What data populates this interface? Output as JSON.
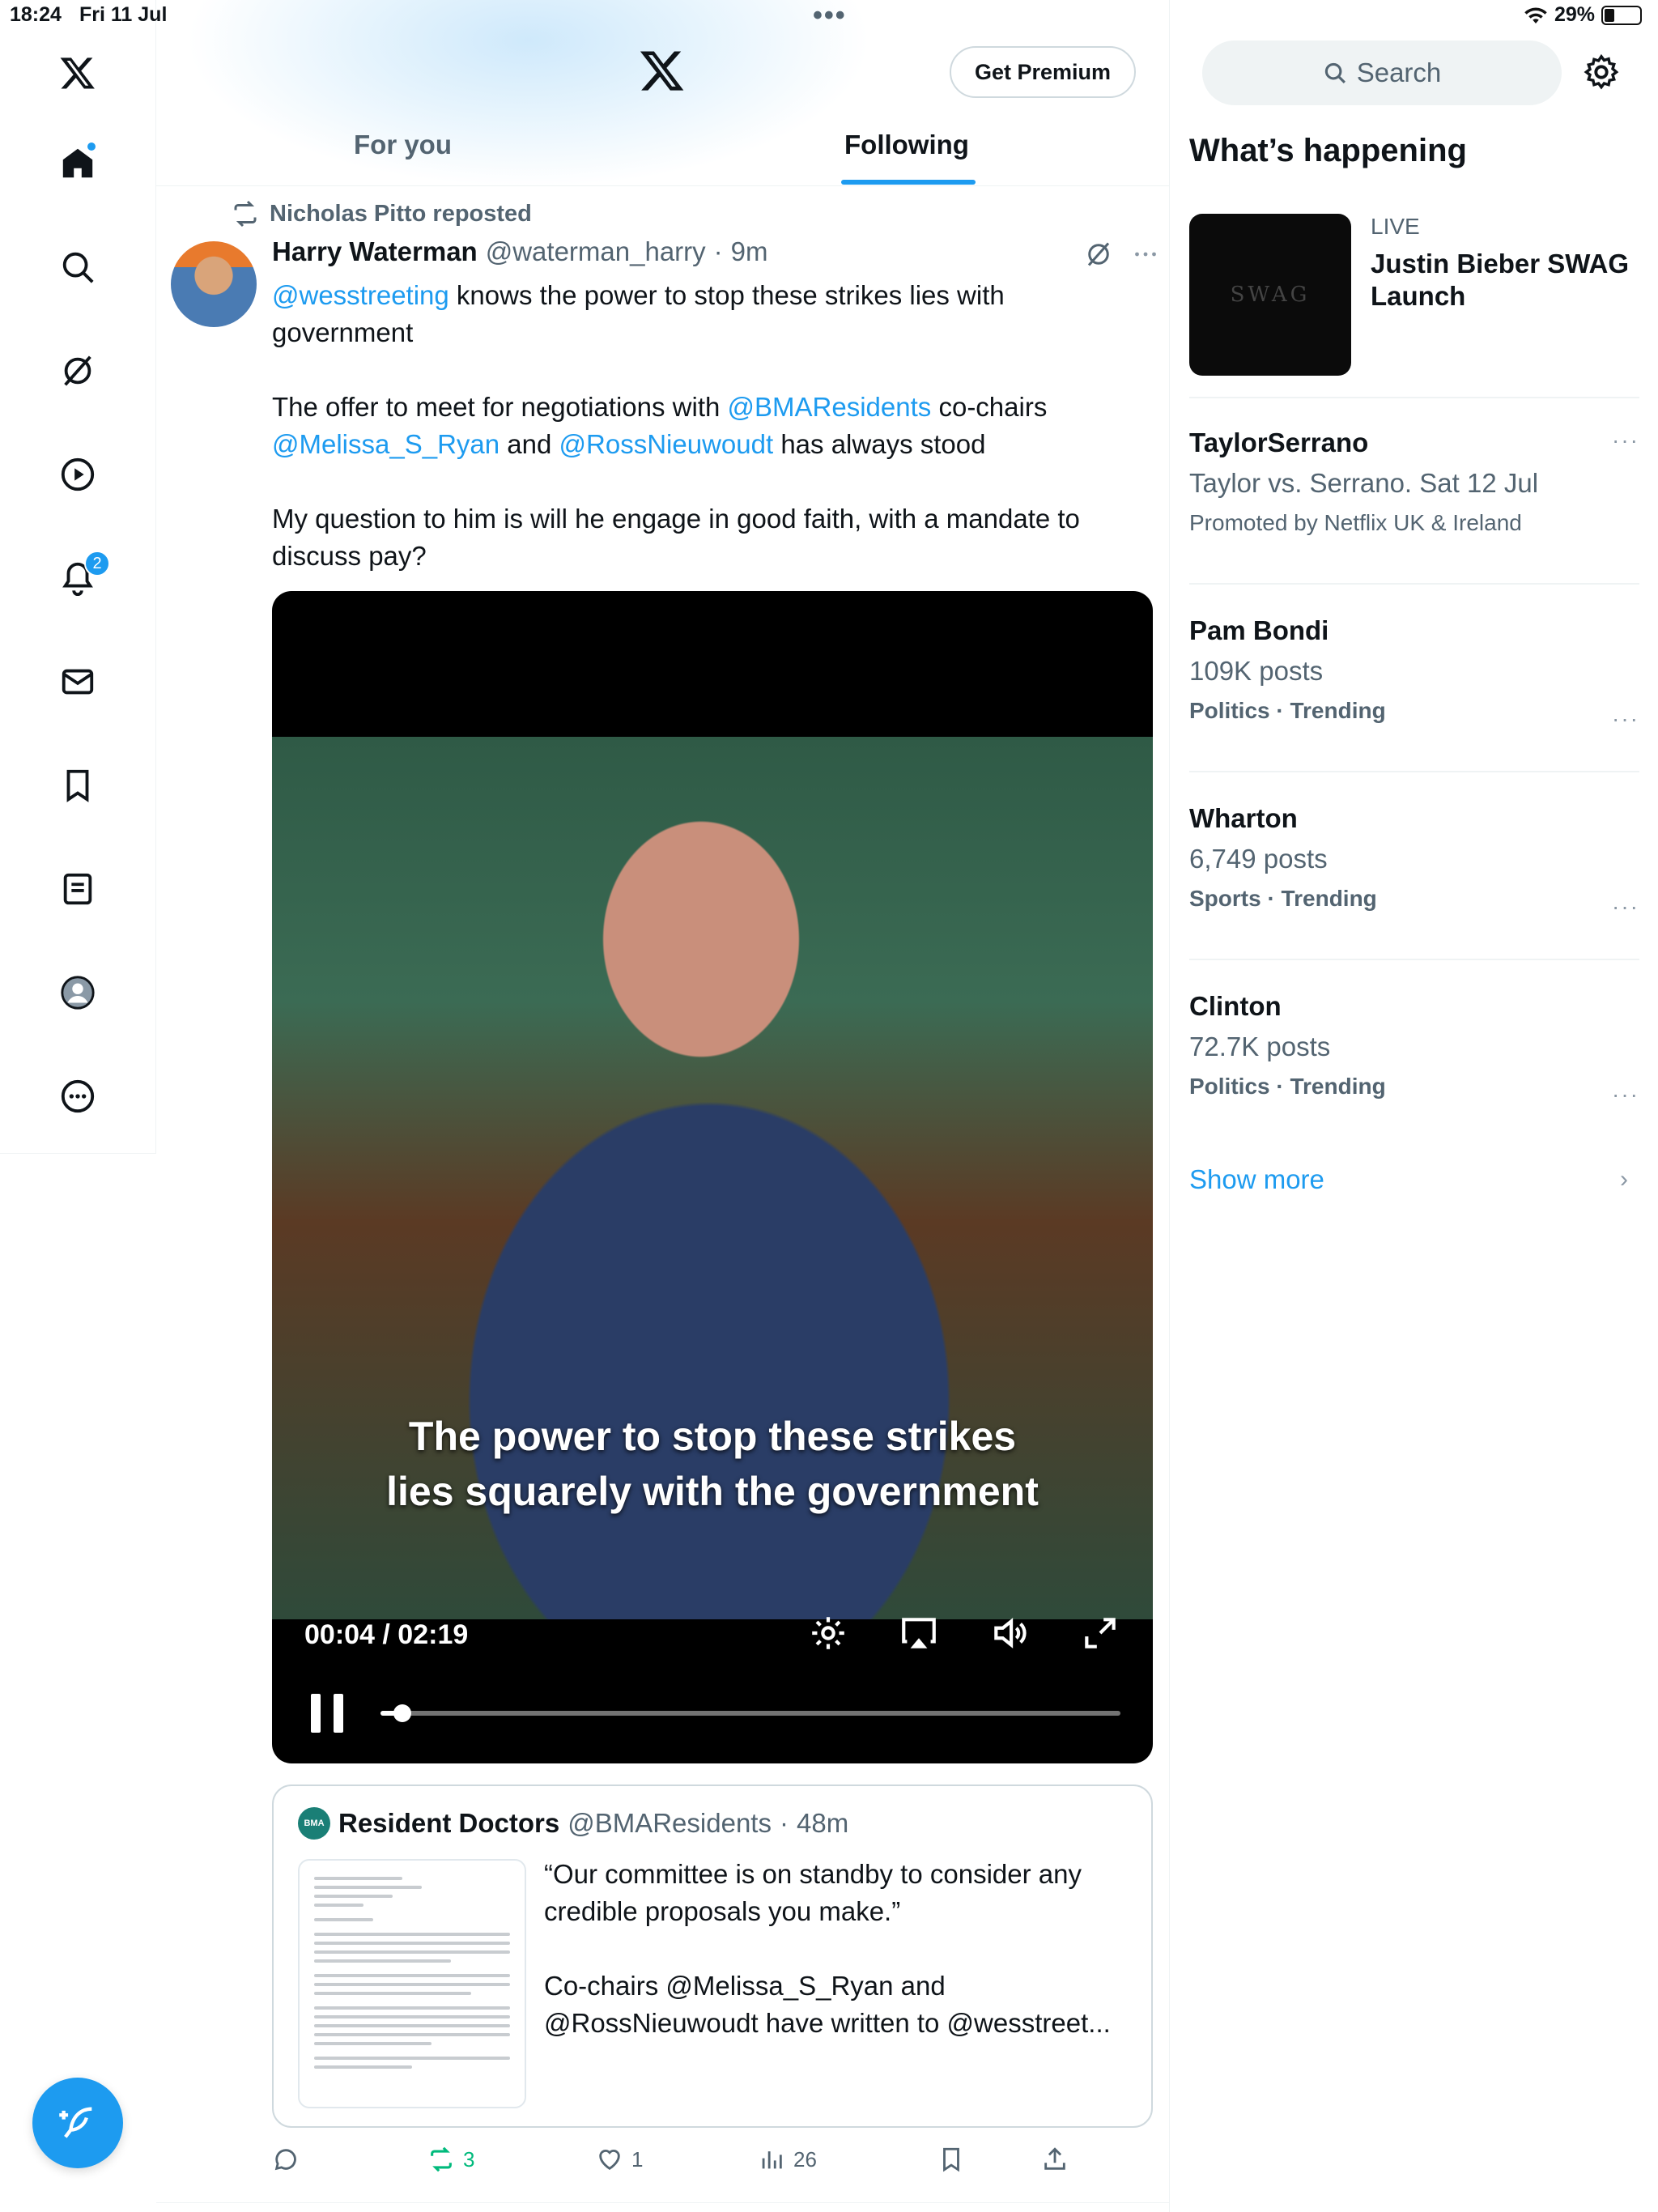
{
  "status_bar": {
    "time": "18:24",
    "date": "Fri 11 Jul",
    "dots": "•••",
    "battery_pct": "29%",
    "battery_level": 0.29
  },
  "nav": {
    "items": [
      "x-logo",
      "home",
      "search",
      "grok",
      "video",
      "notifications",
      "messages",
      "bookmarks",
      "lists",
      "profile",
      "more"
    ],
    "notification_count": "2"
  },
  "header": {
    "premium_label": "Get Premium",
    "tabs": [
      {
        "label": "For you",
        "active": false
      },
      {
        "label": "Following",
        "active": true
      }
    ]
  },
  "post": {
    "repost_line": "Nicholas Pitto reposted",
    "author_name": "Harry Waterman",
    "author_handle": "@waterman_harry",
    "separator": "·",
    "time": "9m",
    "text_p1_mention": "@wesstreeting",
    "text_p1_rest": " knows the power to stop these strikes lies with government",
    "text_p2_a": "The offer to meet for negotiations with ",
    "text_p2_mention1": "@BMAResidents",
    "text_p2_b": " co-chairs ",
    "text_p2_mention2": "@Melissa_S_Ryan",
    "text_p2_c": " and ",
    "text_p2_mention3": "@RossNieuwoudt",
    "text_p2_d": " has always stood",
    "text_p3": "My question to him is will he engage in good faith, with a mandate to discuss pay?",
    "video": {
      "caption_line1": "The power to stop these strikes",
      "caption_line2": "lies squarely with the government",
      "time_display": "00:04 / 02:19",
      "progress": 0.029
    },
    "quote": {
      "logo_text": "BMA",
      "name": "Resident Doctors",
      "handle": "@BMAResidents",
      "separator": "·",
      "time": "48m",
      "text_p1": "“Our committee is on standby to consider any credible proposals you make.”",
      "text_p2": "Co-chairs @Melissa_S_Ryan and @RossNieuwoudt have written to @wesstreet..."
    },
    "actions": {
      "reposts": "3",
      "likes": "1",
      "views": "26"
    }
  },
  "sidebar": {
    "search_placeholder": "Search",
    "heading": "What’s happening",
    "live": {
      "thumb_text": "SWAG",
      "label": "LIVE",
      "title": "Justin Bieber SWAG Launch"
    },
    "trends": [
      {
        "name": "TaylorSerrano",
        "sub": "Taylor vs. Serrano. Sat 12 Jul",
        "meta": "Promoted by Netflix UK & Ireland"
      },
      {
        "name": "Pam Bondi",
        "sub": "109K posts",
        "meta": "Politics · Trending"
      },
      {
        "name": "Wharton",
        "sub": "6,749 posts",
        "meta": "Sports · Trending"
      },
      {
        "name": "Clinton",
        "sub": "72.7K posts",
        "meta": "Politics · Trending"
      }
    ],
    "more_glyph": "···",
    "show_more": "Show more",
    "chevron": "›"
  }
}
